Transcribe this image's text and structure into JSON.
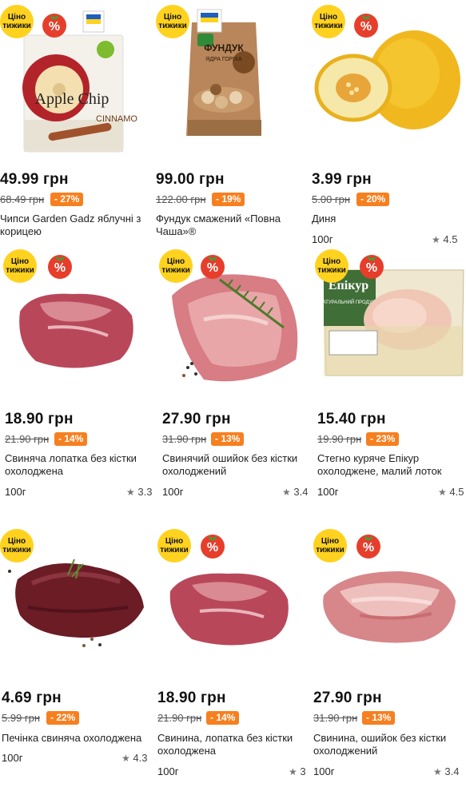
{
  "badge": {
    "line1": "Ціно",
    "line2": "тижики",
    "discount_icon": "%"
  },
  "products": [
    {
      "price": "49.99 грн",
      "old_price": "68.49 грн",
      "discount": "- 27%",
      "title": "Чипси Garden Gadz яблучні з корицею",
      "weight": "",
      "rating": "",
      "pack_text": "Apple Chip",
      "pack_sub": "CINNAMO"
    },
    {
      "price": "99.00 грн",
      "old_price": "122.00 грн",
      "discount": "- 19%",
      "title": "Фундук смажений «Повна Чаша»®",
      "weight": "",
      "rating": "",
      "pack_text": "ФУНДУК",
      "pack_sub": "ЯДРА ГОРІХА"
    },
    {
      "price": "3.99 грн",
      "old_price": "5.00 грн",
      "discount": "- 20%",
      "title": "Диня",
      "weight": "100г",
      "rating": "4.5"
    },
    {
      "price": "18.90 грн",
      "old_price": "21.90 грн",
      "discount": "- 14%",
      "title": "Свиняча лопатка без кістки охолоджена",
      "weight": "100г",
      "rating": "3.3"
    },
    {
      "price": "27.90 грн",
      "old_price": "31.90 грн",
      "discount": "- 13%",
      "title": "Свинячий ошийок без кістки охолоджений",
      "weight": "100г",
      "rating": "3.4"
    },
    {
      "price": "15.40 грн",
      "old_price": "19.90 грн",
      "discount": "- 23%",
      "title": "Стегно куряче Епікур охолоджене, малий лоток",
      "weight": "100г",
      "rating": "4.5",
      "pack_text": "Епікур",
      "pack_sub": "НАТУРАЛЬНИЙ ПРОДУКТ"
    },
    {
      "price": "4.69 грн",
      "old_price": "5.99 грн",
      "discount": "- 22%",
      "title": "Печінка свиняча охолоджена",
      "weight": "100г",
      "rating": "4.3"
    },
    {
      "price": "18.90 грн",
      "old_price": "21.90 грн",
      "discount": "- 14%",
      "title": "Свинина, лопатка без кістки охолоджена",
      "weight": "100г",
      "rating": "3"
    },
    {
      "price": "27.90 грн",
      "old_price": "31.90 грн",
      "discount": "- 13%",
      "title": "Свинина, ошийок без кістки охолоджений",
      "weight": "100г",
      "rating": "3.4"
    }
  ]
}
